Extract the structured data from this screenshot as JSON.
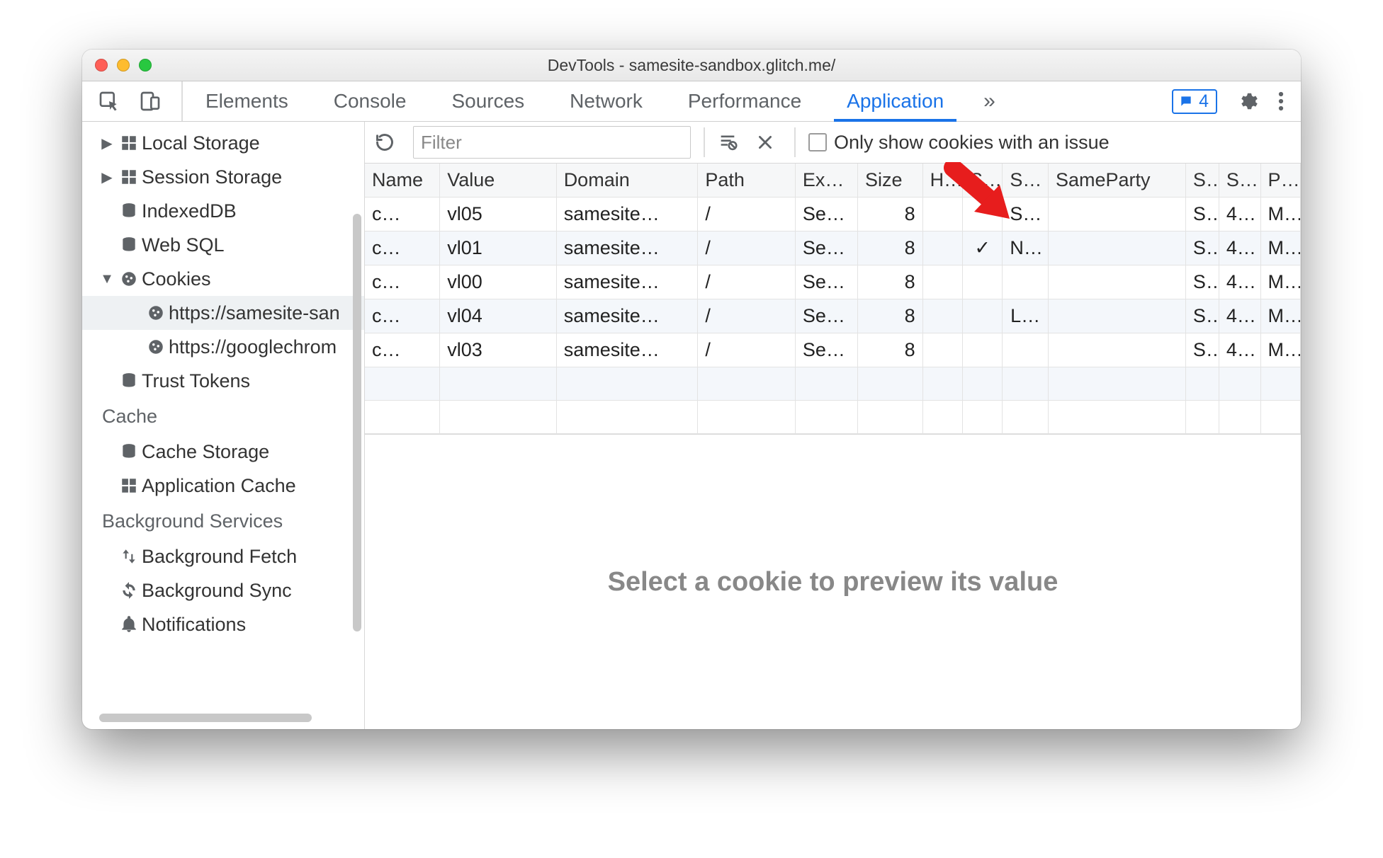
{
  "window": {
    "title": "DevTools - samesite-sandbox.glitch.me/"
  },
  "tabs": {
    "items": [
      "Elements",
      "Console",
      "Sources",
      "Network",
      "Performance",
      "Application"
    ],
    "active": "Application",
    "issues_count": "4"
  },
  "sidebar": {
    "storage": [
      {
        "icon": "grid",
        "label": "Local Storage",
        "arrow": "right"
      },
      {
        "icon": "grid",
        "label": "Session Storage",
        "arrow": "right"
      },
      {
        "icon": "db",
        "label": "IndexedDB",
        "arrow": ""
      },
      {
        "icon": "db",
        "label": "Web SQL",
        "arrow": ""
      },
      {
        "icon": "cookie",
        "label": "Cookies",
        "arrow": "down",
        "children": [
          {
            "label": "https://samesite-san",
            "selected": true
          },
          {
            "label": "https://googlechrom"
          }
        ]
      },
      {
        "icon": "db",
        "label": "Trust Tokens",
        "arrow": ""
      }
    ],
    "cache_header": "Cache",
    "cache": [
      {
        "icon": "db",
        "label": "Cache Storage"
      },
      {
        "icon": "grid",
        "label": "Application Cache"
      }
    ],
    "bg_header": "Background Services",
    "bg": [
      {
        "icon": "updown",
        "label": "Background Fetch"
      },
      {
        "icon": "sync",
        "label": "Background Sync"
      },
      {
        "icon": "bell",
        "label": "Notifications"
      }
    ]
  },
  "toolbar": {
    "filter_placeholder": "Filter",
    "only_issues_label": "Only show cookies with an issue"
  },
  "table": {
    "headers": [
      "Name",
      "Value",
      "Domain",
      "Path",
      "Ex…",
      "Size",
      "H…",
      "S…",
      "S…",
      "SameParty",
      "S..",
      "S…",
      "P…"
    ],
    "rows": [
      {
        "name": "c…",
        "value": "vl05",
        "domain": "samesite…",
        "path": "/",
        "ex": "Se…",
        "size": "8",
        "h": "",
        "s1": "",
        "s2": "S…",
        "sameparty": "",
        "s3": "S..",
        "s4": "4…",
        "p": "M…"
      },
      {
        "name": "c…",
        "value": "vl01",
        "domain": "samesite…",
        "path": "/",
        "ex": "Se…",
        "size": "8",
        "h": "",
        "s1": "✓",
        "s2": "N…",
        "sameparty": "",
        "s3": "S..",
        "s4": "4…",
        "p": "M…"
      },
      {
        "name": "c…",
        "value": "vl00",
        "domain": "samesite…",
        "path": "/",
        "ex": "Se…",
        "size": "8",
        "h": "",
        "s1": "",
        "s2": "",
        "sameparty": "",
        "s3": "S..",
        "s4": "4…",
        "p": "M…"
      },
      {
        "name": "c…",
        "value": "vl04",
        "domain": "samesite…",
        "path": "/",
        "ex": "Se…",
        "size": "8",
        "h": "",
        "s1": "",
        "s2": "L…",
        "sameparty": "",
        "s3": "S..",
        "s4": "4…",
        "p": "M…"
      },
      {
        "name": "c…",
        "value": "vl03",
        "domain": "samesite…",
        "path": "/",
        "ex": "Se…",
        "size": "8",
        "h": "",
        "s1": "",
        "s2": "",
        "sameparty": "",
        "s3": "S..",
        "s4": "4…",
        "p": "M…"
      }
    ]
  },
  "preview_text": "Select a cookie to preview its value"
}
